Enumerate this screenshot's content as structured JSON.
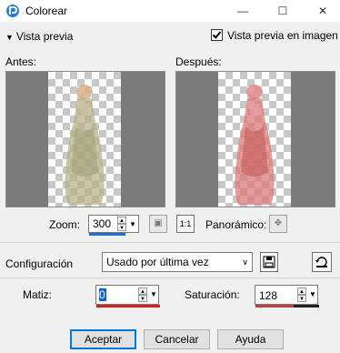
{
  "window": {
    "title": "Colorear"
  },
  "preview": {
    "toggle_label": "Vista previa",
    "checkbox_label": "Vista previa en imagen",
    "checkbox_checked": true,
    "before_label": "Antes:",
    "after_label": "Después:"
  },
  "zoom": {
    "label": "Zoom:",
    "value": "300",
    "pan_label": "Panorámico:"
  },
  "settings": {
    "label": "Configuración",
    "selected": "Usado por última vez"
  },
  "params": {
    "hue_label": "Matiz:",
    "hue_value": "0",
    "saturation_label": "Saturación:",
    "saturation_value": "128"
  },
  "buttons": {
    "ok": "Aceptar",
    "cancel": "Cancelar",
    "help": "Ayuda"
  },
  "colors": {
    "accent": "#0078d7",
    "hue_bar": "#d22020",
    "saturation_bar": "#c04040"
  }
}
